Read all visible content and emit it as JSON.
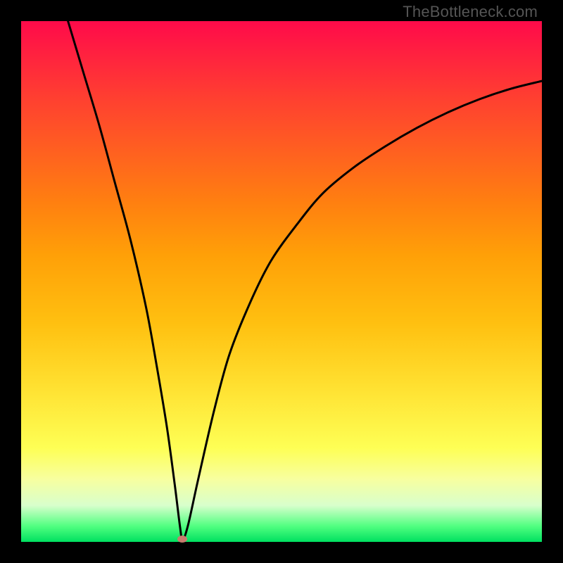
{
  "watermark": "TheBottleneck.com",
  "chart_data": {
    "type": "line",
    "title": "",
    "xlabel": "",
    "ylabel": "",
    "xlim": [
      0,
      100
    ],
    "ylim": [
      0,
      100
    ],
    "grid": false,
    "series": [
      {
        "name": "bottleneck-curve",
        "x": [
          9,
          12,
          15,
          18,
          21,
          24,
          26,
          28,
          29.5,
          30.5,
          31,
          32,
          34,
          37,
          40,
          44,
          48,
          53,
          58,
          64,
          70,
          76,
          82,
          88,
          94,
          100
        ],
        "y": [
          100,
          90,
          80,
          69,
          58,
          45,
          34,
          22,
          11,
          3,
          0.5,
          3,
          12,
          25,
          36,
          46,
          54,
          61,
          67,
          72,
          76,
          79.5,
          82.5,
          85,
          87,
          88.5
        ]
      }
    ],
    "min_point": {
      "x": 31,
      "y": 0.5
    }
  }
}
